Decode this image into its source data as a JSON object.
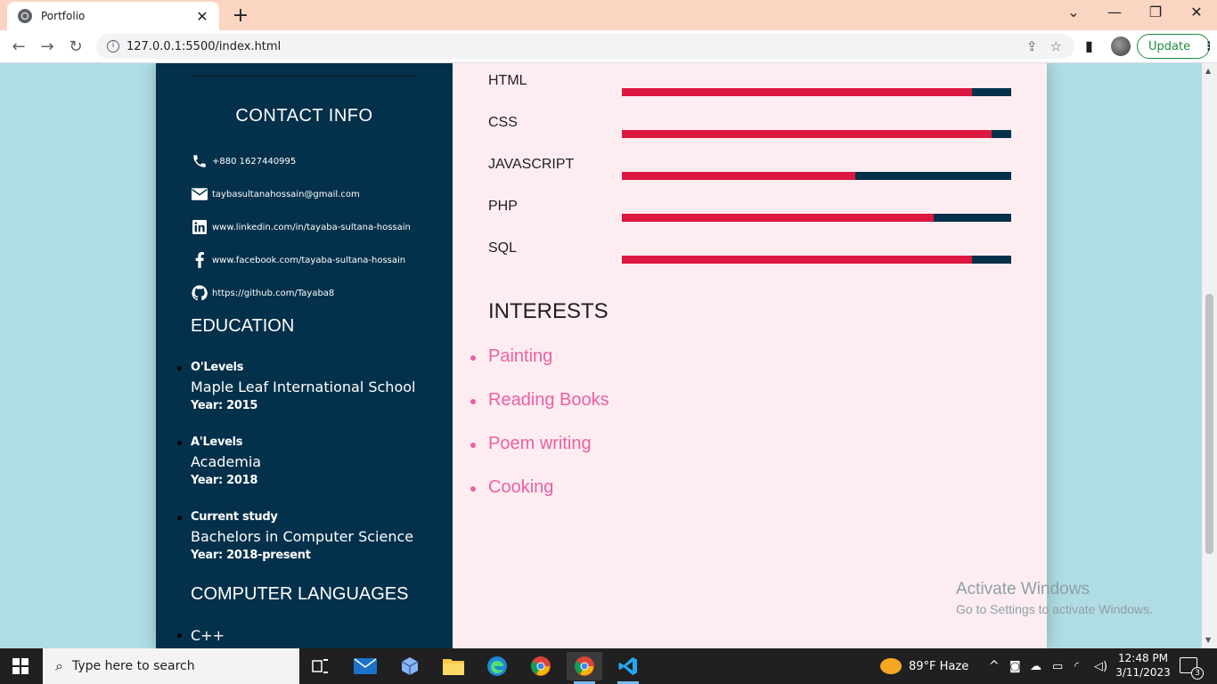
{
  "browser": {
    "tab_title": "Portfolio",
    "tab_close": "✕",
    "new_tab": "+",
    "url": "127.0.0.1:5500/index.html",
    "update_label": "Update",
    "window_controls": [
      "⌄",
      "—",
      "❐",
      "✕"
    ]
  },
  "contact": {
    "title": "CONTACT INFO",
    "items": [
      {
        "icon": "phone-icon",
        "text": "+880 1627440995"
      },
      {
        "icon": "envelope-icon",
        "text": "taybasultanahossain@gmail.com"
      },
      {
        "icon": "linkedin-icon",
        "text": "www.linkedin.com/in/tayaba-sultana-hossain"
      },
      {
        "icon": "facebook-icon",
        "text": "www.facebook.com/tayaba-sultana-hossain"
      },
      {
        "icon": "github-icon",
        "text": "https://github.com/Tayaba8"
      }
    ]
  },
  "education": {
    "title": "EDUCATION",
    "items": [
      {
        "level": "O'Levels",
        "school": "Maple Leaf International School",
        "year": "Year: 2015"
      },
      {
        "level": "A'Levels",
        "school": "Academia",
        "year": "Year: 2018"
      },
      {
        "level": "Current study",
        "school": "Bachelors in Computer Science",
        "year": "Year: 2018-present"
      }
    ]
  },
  "computer_languages": {
    "title": "COMPUTER LANGUAGES",
    "items": [
      "C++"
    ]
  },
  "skills": [
    {
      "name": "HTML",
      "level": 0.9
    },
    {
      "name": "CSS",
      "level": 0.95
    },
    {
      "name": "JAVASCRIPT",
      "level": 0.6
    },
    {
      "name": "PHP",
      "level": 0.8
    },
    {
      "name": "SQL",
      "level": 0.9
    }
  ],
  "interests": {
    "title": "INTERESTS",
    "items": [
      "Painting",
      "Reading Books",
      "Poem writing",
      "Cooking"
    ]
  },
  "watermark": {
    "line1": "Activate Windows",
    "line2": "Go to Settings to activate Windows."
  },
  "taskbar": {
    "search_placeholder": "Type here to search",
    "weather": "89°F  Haze",
    "time": "12:48 PM",
    "date": "3/11/2023",
    "notification_count": "3"
  },
  "colors": {
    "sidebar": "#03304a",
    "bar_fill": "#dc1740",
    "interest_pink": "#ef5ea2",
    "page_bg": "#b0dde4",
    "right_panel": "#fdedf1"
  }
}
